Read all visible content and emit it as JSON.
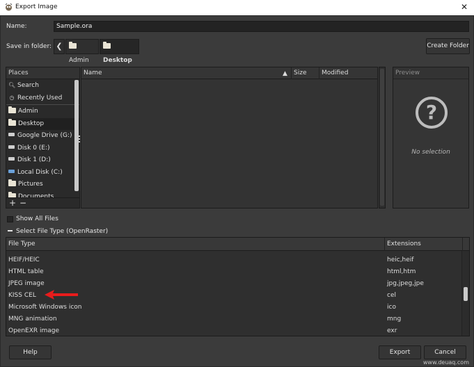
{
  "window": {
    "title": "Export Image",
    "close_label": "✕"
  },
  "name": {
    "label": "Name:",
    "value": "Sample.ora"
  },
  "save_in": {
    "label": "Save in folder:",
    "back_label": "❮",
    "crumbs": [
      "Admin",
      "Desktop"
    ],
    "create_folder_label": "Create Folder"
  },
  "places": {
    "header": "Places",
    "items": [
      {
        "label": "Search",
        "icon": "search-icon"
      },
      {
        "label": "Recently Used",
        "icon": "clock-icon"
      },
      {
        "label": "Admin",
        "icon": "folder-icon"
      },
      {
        "label": "Desktop",
        "icon": "folder-icon"
      },
      {
        "label": "Google Drive (G:)",
        "icon": "drive-icon"
      },
      {
        "label": "Disk 0 (E:)",
        "icon": "drive-icon"
      },
      {
        "label": "Disk 1 (D:)",
        "icon": "drive-icon"
      },
      {
        "label": "Local Disk (C:)",
        "icon": "drive-icon"
      },
      {
        "label": "Pictures",
        "icon": "folder-icon"
      },
      {
        "label": "Documents",
        "icon": "folder-icon"
      }
    ],
    "add_label": "+",
    "remove_label": "−"
  },
  "files": {
    "col_name": "Name",
    "col_size": "Size",
    "col_modified": "Modified"
  },
  "preview": {
    "header": "Preview",
    "icon_glyph": "?",
    "empty_text": "No selection"
  },
  "show_all_files": "Show All Files",
  "select_file_type": "Select File Type (OpenRaster)",
  "file_types": {
    "col_type": "File Type",
    "col_ext": "Extensions",
    "rows": [
      {
        "type": "HEIF/HEIC",
        "ext": "heic,heif"
      },
      {
        "type": "HTML table",
        "ext": "html,htm"
      },
      {
        "type": "JPEG image",
        "ext": "jpg,jpeg,jpe"
      },
      {
        "type": "KISS CEL",
        "ext": "cel"
      },
      {
        "type": "Microsoft Windows icon",
        "ext": "ico"
      },
      {
        "type": "MNG animation",
        "ext": "mng"
      },
      {
        "type": "OpenEXR image",
        "ext": "exr"
      }
    ]
  },
  "buttons": {
    "help": "Help",
    "export": "Export",
    "cancel": "Cancel"
  },
  "watermark": "www.deuaq.com",
  "colors": {
    "dialog_bg": "#3b3b3b",
    "arrow": "#e81c1c"
  }
}
